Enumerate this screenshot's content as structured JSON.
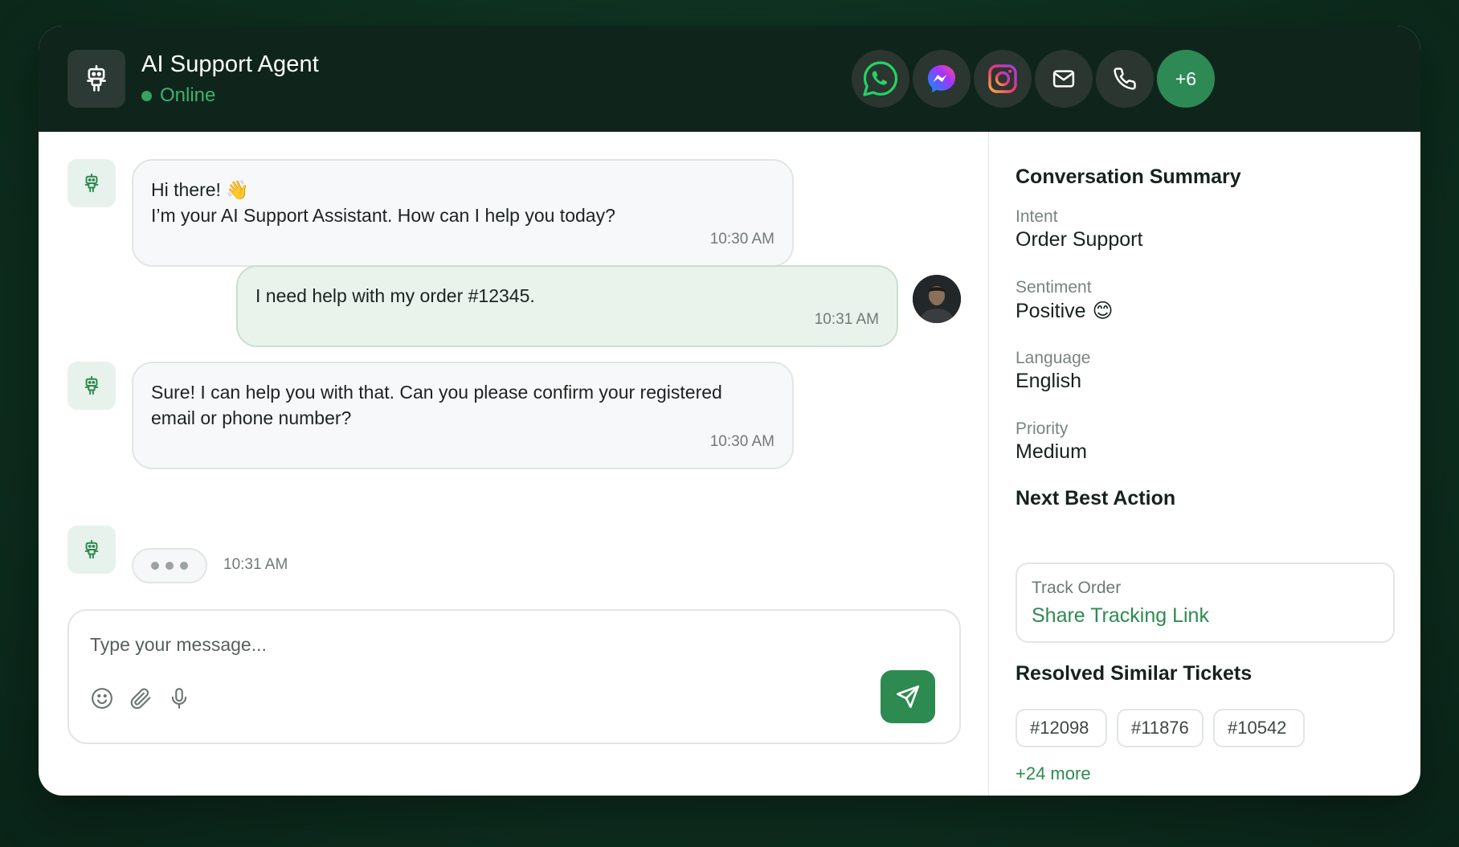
{
  "header": {
    "agent_name": "AI Support Agent",
    "status": "Online",
    "channels": [
      {
        "name": "whatsapp",
        "icon": "whatsapp-icon",
        "color": "#25D366"
      },
      {
        "name": "messenger",
        "icon": "messenger-icon",
        "color": "#A334FA"
      },
      {
        "name": "instagram",
        "icon": "instagram-icon",
        "color": "#E1306C"
      },
      {
        "name": "email",
        "icon": "mail-icon",
        "color": "#FFFFFF"
      },
      {
        "name": "phone",
        "icon": "phone-icon",
        "color": "#FFFFFF"
      }
    ],
    "more_channels": "+6"
  },
  "messages": [
    {
      "sender": "bot",
      "lines": [
        "Hi there! 👋",
        "I’m your AI Support Assistant. How can I help you today?"
      ],
      "time": "10:30 AM"
    },
    {
      "sender": "user",
      "lines": [
        "I need help with my order #12345."
      ],
      "time": "10:31 AM"
    },
    {
      "sender": "bot",
      "lines": [
        "Sure! I can help you with that. Can you please confirm your registered",
        "email or phone number?"
      ],
      "time": "10:30 AM"
    }
  ],
  "typing": {
    "time": "10:31 AM"
  },
  "composer": {
    "placeholder": "Type your message..."
  },
  "summary": {
    "title": "Conversation Summary",
    "intent_label": "Intent",
    "intent_value": "Order Support",
    "sentiment_label": "Sentiment",
    "sentiment_value": "Positive",
    "sentiment_emoji": "😊",
    "language_label": "Language",
    "language_value": "English",
    "priority_label": "Priority",
    "priority_value": "Medium"
  },
  "next_action": {
    "title": "Next Best Action",
    "kind": "Track Order",
    "label": "Share Tracking Link"
  },
  "similar": {
    "title": "Resolved Similar Tickets",
    "tickets": [
      "#12098",
      "#11876",
      "#10542"
    ],
    "more": "+24 more"
  },
  "colors": {
    "accent": "#2D8A51",
    "header_bg": "#0F251C",
    "online": "#3FB26A"
  }
}
